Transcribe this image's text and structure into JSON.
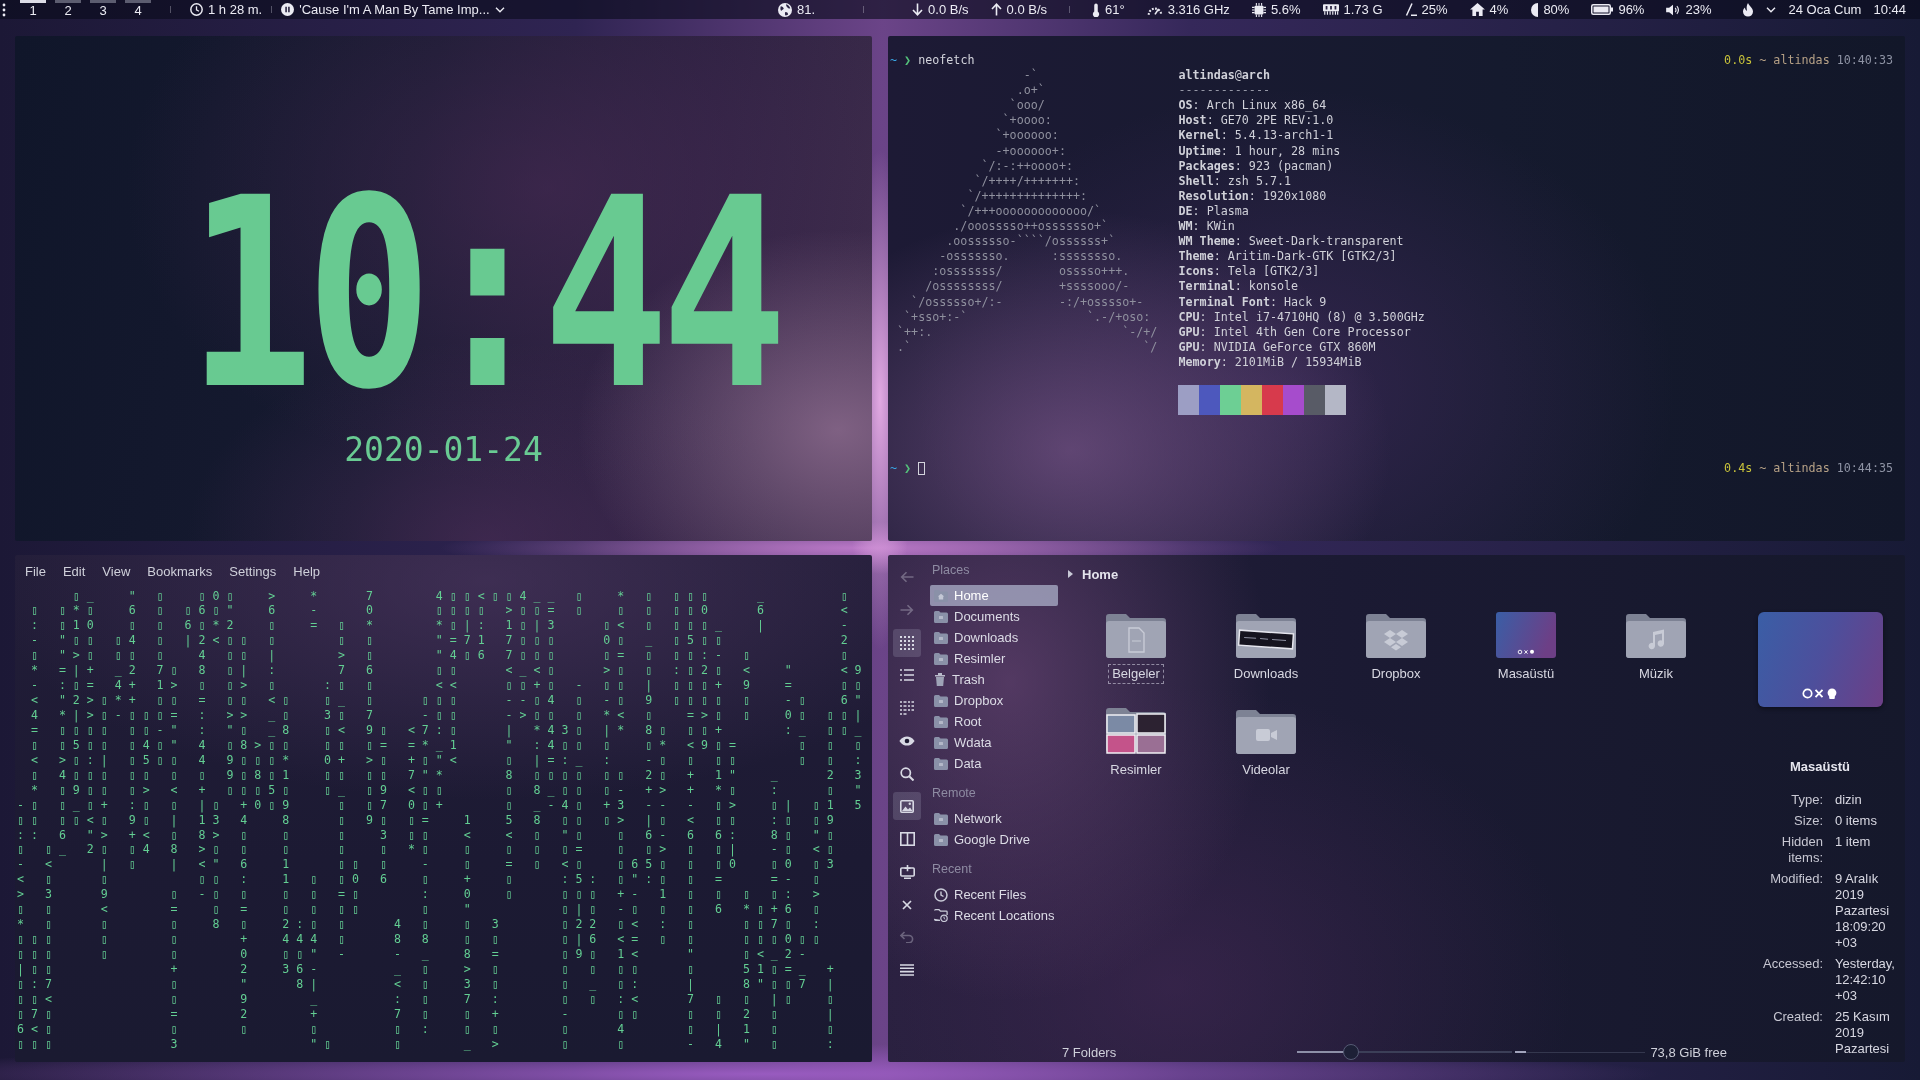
{
  "top_panel": {
    "pager": [
      {
        "label": "1",
        "selected": true
      },
      {
        "label": "2",
        "selected": false
      },
      {
        "label": "3",
        "selected": false
      },
      {
        "label": "4",
        "selected": false
      }
    ],
    "tasks": [
      {
        "kind": "uptime",
        "text": "1 h 28 m."
      },
      {
        "kind": "media",
        "text": "'Cause I'm A Man By Tame Imp...",
        "playing": true
      }
    ],
    "sensors": [
      {
        "kind": "weather",
        "text": "81."
      },
      {
        "kind": "download",
        "text": "0.0 B/s"
      },
      {
        "kind": "upload",
        "text": "0.0 B/s"
      },
      {
        "kind": "temperature",
        "text": "61°"
      },
      {
        "kind": "frequency",
        "text": "3.316 GHz"
      },
      {
        "kind": "cpu",
        "text": "5.6%"
      },
      {
        "kind": "memory",
        "text": "1.73 G"
      },
      {
        "kind": "root",
        "text": "25%"
      },
      {
        "kind": "home",
        "text": "4%"
      },
      {
        "kind": "brightness",
        "text": "80%"
      },
      {
        "kind": "battery",
        "text": "96%"
      },
      {
        "kind": "volume",
        "text": "23%"
      }
    ],
    "clock": {
      "date": "24 Oca Cum",
      "time": "10:44"
    }
  },
  "clock_widget": {
    "time": "10:44",
    "date": "2020-01-24"
  },
  "terminal": {
    "prompts": [
      {
        "dir": "~",
        "symbol": "❯",
        "command": "neofetch",
        "cursor": false,
        "duration": "0.0s",
        "context": "~ altindas",
        "time": "10:40:33"
      },
      {
        "dir": "~",
        "symbol": "❯",
        "cursor": true,
        "duration": "0.4s",
        "context": "~ altindas",
        "time": "10:44:35"
      }
    ],
    "logo": [
      "                   -`",
      "                  .o+`",
      "                 `ooo/",
      "                `+oooo:",
      "               `+oooooo:",
      "               -+oooooo+:",
      "             `/:-:++oooo+:",
      "            `/++++/+++++++:",
      "           `/++++++++++++++:",
      "          `/+++ooooooooooooo/`",
      "         ./ooosssso++osssssso+`",
      "        .oossssso-````/ossssss+`",
      "       -osssssso.      :ssssssso.",
      "      :osssssss/        osssso+++.",
      "     /ossssssss/        +ssssooo/-",
      "   `/ossssso+/:-        -:/+osssso+-",
      "  `+sso+:-`                 `.-/+oso:",
      " `++:.                           `-/+/",
      " .`                                 `/"
    ],
    "title": "**altindas**@**arch**",
    "rule": "-------------",
    "info": [
      "**OS**: Arch Linux x86_64",
      "**Host**: GE70 2PE REV:1.0",
      "**Kernel**: 5.4.13-arch1-1",
      "**Uptime**: 1 hour, 28 mins",
      "**Packages**: 923 (pacman)",
      "**Shell**: zsh 5.7.1",
      "**Resolution**: 1920x1080",
      "**DE**: Plasma",
      "**WM**: KWin",
      "**WM Theme**: Sweet-Dark-transparent",
      "**Theme**: Aritim-Dark-GTK [GTK2/3]",
      "**Icons**: Tela [GTK2/3]",
      "**Terminal**: konsole",
      "**Terminal Font**: Hack 9",
      "**CPU**: Intel i7-4710HQ (8) @ 3.500GHz",
      "**GPU**: Intel 4th Gen Core Processor",
      "**GPU**: NVIDIA GeForce GTX 860M",
      "**Memory**: 2101MiB / 15934MiB"
    ],
    "palette": [
      {
        "color": "#9c9ec4"
      },
      {
        "color": "#4d58bd"
      },
      {
        "color": "#6dcf94"
      },
      {
        "color": "#d4b660"
      },
      {
        "color": "#d73a4c"
      },
      {
        "color": "#a64ccc"
      },
      {
        "color": "#585b66"
      },
      {
        "color": "#b4b7c6"
      }
    ]
  },
  "konsole": {
    "menu": [
      "File",
      "Edit",
      "View",
      "Bookmarks",
      "Settings",
      "Help"
    ],
    "rows": [
      "    ▯_  \" ▯  ▯0▯  >  *   7    4▯▯<▯▯4__ ▯  * ▯ ▯▯▯   _     ▯",
      " ▯ ▯*▯  6 ▯ ▯6▯\"  6  -   0    ▯▯▯▯ >▯▯= ▯  ▯ ▯ ▯▯0   6     <",
      " : ▯10  ▯ ▯ 6▯*2  ▯  = ▯ *    *▯|: 1▯|3   ▯< ▯ ▯▯▯_  |     -",
      " - \"▯▯ ▯4 ▯ |2<▯▯ ▯    ▯ ▯    \"=71 7▯▯▯   0▯ _ ▯5▯▯        2",
      " ▯ \">▯ ▯▯ ▯  4 ▯▯ |    > ▯    \"4▯6 7▯▯▯   ▯= ▯ ▯▯:- ▯      ▯",
      " * =|+ _2 7▯ 8 ▯| :    7 6    ▯▯   <_<▯   >▯ ▯ :▯2▯ <  \"   <9",
      " - :▯= 4+ 1> ▯ ▯> ▯   :▯ ▯    <<   ▯▯+▯ - ▯▯ | ▯▯▯+ 9  =   ▯▯",
      " < \"2>▯*+ ▯▯ = ▯▯ <▯  ▯_ ▯   ▯▯▯   --▯4 ▯ -▯ 9 ▯▯▯▯ ▯  -▯  6\"",
      " 4 *|>▯-▯▯▯= : >> _▯  3▯ 7   -▯▯   ->▯▯ ▯ *< ▯  =>▯ ▯  0▯ ▯▯|",
      " = ▯▯▯▯ ▯▯-\" : \"▯ _8  ▯< 9▯ <7:▯   | *43▯ |* 8▯ ▯▯+    :_ ▯▯_",
      " ▯ ▯5▯▯ ▯4▯\" 4 ▯8>▯▯  ▯▯ ▯= =*_1   \" :4▯▯ ▯  ▯* <9▯=    ▯ ▯ ▯",
      " < >▯:| ▯5▯▯ 4 9▯▯▯*  0+ >▯ +▯\"<   ▯ |=:_ :  -▯ ▯ ▯▯    ▯ ▯ :",
      " ▯ 4▯▯▯ ▯▯ ▯ ▯ 9▯8▯1  ▯▯ ▯▯ 7\"*    8 ▯▯▯▯ ▯▯ 2▯ + 1\"  _   2 3",
      " * ▯9▯▯ ▯> < + ▯▯▯5▯  ▯_ ▯9 <▯▯    ▯ 8_▯▯ ▯- +> + *▯  :   ▯ \"",
      "-▯ ▯_▯+ :▯ ▯ |▯ +0▯9   ▯ ▯7 0▯+    ▯ _-4▯ +3 -- - ▯>  ▯| ▯1 5",
      "▯▯ ▯▯<▯ 9▯ | 13 4  8   ▯ 9▯ ▯=  1  5 8 ▯▯ ▯> |▯ < ▯▯  :▯ ▯9",
      ":: 6 \"> +< ▯ 8> ▯  ▯   ▯  3 ▯▯  <  < ▯ \"▯  ▯ 6- 6 6:  8▯ \"▯",
      "▯ ▯_ 2▯ ▯4 8 >▯ ▯  ▯   ▯  ▯ *▯  ▯  ▯ ▯ ▯=  ▯ ▯> ▯ ▯|  -▯ <▯",
      "- <   | ▯  | <\" 6  1   ▯▯ ▯  -  ▯  = ▯ <▯  ▯65▯ ▯ ▯0  ▯0 ▯3",
      "< ▯   ▯      ▯▯ :  1 ▯ ▯0 6  ▯  +  ▯   :5: ▯\":▯ ▯ =   =- ▯",
      "> 3   9    ▯ -▯ ▯  ▯ ▯ =▯    :  0  ▯   ▯▯▯ +- 1 ▯ ▯ ▯ ▯: >",
      "▯ ▯   <    =  ▯ =  ▯ ▯ ▯▯    ▯  \"      ▯|▯ -▯ ▯ ▯ 6 *▯+6 ▯",
      "* ▯   ▯    ▯  8 ▯  2:▯ ▯   4 ▯  ▯ 3    ▯22 ▯< : ▯   ▯▯7▯ :",
      "▯▯▯   ▯    ▯    +  444 ▯   8 8  ▯ ▯    ▯|6 <= ▯ ▯   ▯▯▯0▯▯",
      "▯▯▯   ▯    ▯    0  ▯▯\" -   - _  8 =    ▯9▯ 1<   \"   ▯<_2-",
      "|▯▯        +    2  36-     _ ▯  > ▯    ▯ ▯ ▯▯   ▯   51▯=_ +",
      "▯:7        ▯    \"   8|     < ▯  3 ▯    ▯ _ ▯:   |   8\"▯▯7 |",
      "▯▯<        ▯    9    _     : ▯  7 :    ▯ ▯ :<   7 ▯ ▯ |▯  ▯",
      "▯7▯        =    2    +     7 ▯  ▯ +    -   ▯▯   ▯ ▯ 2 ▯   |",
      "6<▯        ▯    ▯    ▯     ▯ :  ▯ ▯    ▯   4    ▯ | 1 ▯   ▯",
      "▯▯▯        3         \"▯    ▯    _ >    ▯   ▯    - 4 \" ▯   :"
    ]
  },
  "file_manager": {
    "toolbar": [
      {
        "kind": "back",
        "selected": false,
        "disabled": true
      },
      {
        "kind": "forward",
        "selected": false,
        "disabled": true
      },
      {
        "kind": "icons",
        "selected": true,
        "disabled": false
      },
      {
        "kind": "details",
        "selected": false,
        "disabled": false
      },
      {
        "kind": "compact",
        "selected": false,
        "disabled": false
      },
      {
        "kind": "preview",
        "selected": false,
        "disabled": false
      },
      {
        "kind": "search",
        "selected": false,
        "disabled": false
      },
      {
        "kind": "image",
        "selected": true,
        "disabled": false
      },
      {
        "kind": "split",
        "selected": false,
        "disabled": false
      },
      {
        "kind": "terminal",
        "selected": false,
        "disabled": false
      },
      {
        "kind": "close",
        "selected": false,
        "disabled": false
      },
      {
        "kind": "undo",
        "selected": false,
        "disabled": true
      },
      {
        "kind": "menu",
        "selected": false,
        "disabled": false
      }
    ],
    "places": [
      {
        "heading": "Places",
        "items": [
          {
            "label": "Home",
            "kind": "home",
            "selected": true
          },
          {
            "label": "Documents",
            "kind": "folder",
            "selected": false
          },
          {
            "label": "Downloads",
            "kind": "folder",
            "selected": false
          },
          {
            "label": "Resimler",
            "kind": "folder",
            "selected": false
          },
          {
            "label": "Trash",
            "kind": "trash",
            "selected": false
          },
          {
            "label": "Dropbox",
            "kind": "folder",
            "selected": false
          },
          {
            "label": "Root",
            "kind": "folder",
            "selected": false
          },
          {
            "label": "Wdata",
            "kind": "folder",
            "selected": false
          },
          {
            "label": "Data",
            "kind": "folder",
            "selected": false
          }
        ]
      },
      {
        "heading": "Remote",
        "items": [
          {
            "label": "Network",
            "kind": "folder",
            "selected": false
          },
          {
            "label": "Google Drive",
            "kind": "folder",
            "selected": false
          }
        ]
      },
      {
        "heading": "Recent",
        "items": [
          {
            "label": "Recent Files",
            "kind": "clock",
            "selected": false
          },
          {
            "label": "Recent Locations",
            "kind": "history",
            "selected": false
          }
        ]
      }
    ],
    "breadcrumb": "Home",
    "folders": [
      {
        "name": "Belgeler",
        "kind": "documents",
        "focused": true
      },
      {
        "name": "Downloads",
        "kind": "downloads",
        "focused": false
      },
      {
        "name": "Dropbox",
        "kind": "dropbox",
        "focused": false
      },
      {
        "name": "Masaüstü",
        "kind": "desktop",
        "focused": false
      },
      {
        "name": "Müzik",
        "kind": "music",
        "focused": false
      },
      {
        "name": "Resimler",
        "kind": "pictures",
        "focused": false
      },
      {
        "name": "Videolar",
        "kind": "videos",
        "focused": false
      }
    ],
    "information": {
      "title": "Masaüstü",
      "fields": [
        {
          "label": "Type:",
          "value": "dizin"
        },
        {
          "label": "Size:",
          "value": "0 items"
        },
        {
          "label": "Hidden items:",
          "value": "1 item"
        },
        {
          "label": "Modified:",
          "value": "9 Aralık 2019 Pazartesi 18:09:20 +03"
        },
        {
          "label": "Accessed:",
          "value": "Yesterday, 12:42:10 +03"
        },
        {
          "label": "Created:",
          "value": "25 Kasım 2019 Pazartesi"
        }
      ]
    },
    "status_bar": {
      "summary": "7 Folders",
      "zoom": {
        "level": 0.25
      },
      "space": {
        "level": 0.08,
        "text": "73,8 GiB free"
      }
    }
  }
}
